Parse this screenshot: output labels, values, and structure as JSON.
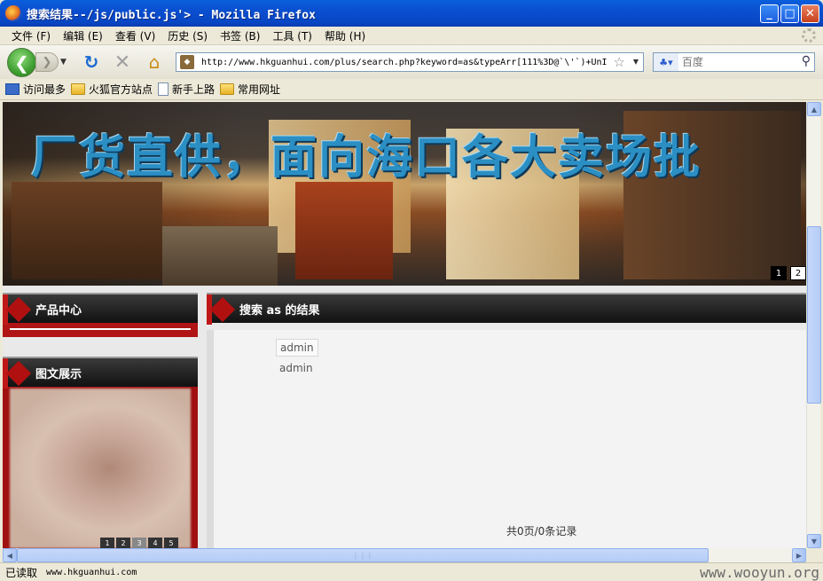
{
  "window": {
    "title": "搜索结果--/js/public.js'> - Mozilla Firefox",
    "minimize": "_",
    "maximize": "□",
    "close": "✕"
  },
  "menu": [
    "文件 (F)",
    "编辑 (E)",
    "查看 (V)",
    "历史 (S)",
    "书签 (B)",
    "工具 (T)",
    "帮助 (H)"
  ],
  "nav": {
    "url": "http://www.hkguanhui.com/plus/search.php?keyword=as&typeArr[111%3D@`\\'`)+UnI",
    "search_placeholder": "百度",
    "back_icon": "back-arrow-icon",
    "reload_icon": "reload-icon",
    "stop_icon": "stop-icon",
    "home_icon": "home-icon"
  },
  "bookmarks": [
    {
      "label": "访问最多",
      "icon": "star"
    },
    {
      "label": "火狐官方站点",
      "icon": "folder"
    },
    {
      "label": "新手上路",
      "icon": "page"
    },
    {
      "label": "常用网址",
      "icon": "folder"
    }
  ],
  "banner": {
    "text": "厂货直供，面向海口各大卖场批",
    "dots": [
      "1",
      "2"
    ]
  },
  "sidebar": {
    "product_center": "产品中心",
    "gallery_title": "图文展示",
    "gallery_dots": [
      "1",
      "2",
      "3",
      "4",
      "5"
    ]
  },
  "main": {
    "heading": "搜索 as 的结果",
    "results": [
      "admin",
      "admin"
    ],
    "pager": "共0页/0条记录"
  },
  "status": {
    "text": "已读取",
    "url": "www.hkguanhui.com",
    "watermark": "www.wooyun.org"
  },
  "colors": {
    "titlebar": "#0a4fd0",
    "banner_text": "#2b8fc4",
    "accent_red": "#b01414"
  }
}
